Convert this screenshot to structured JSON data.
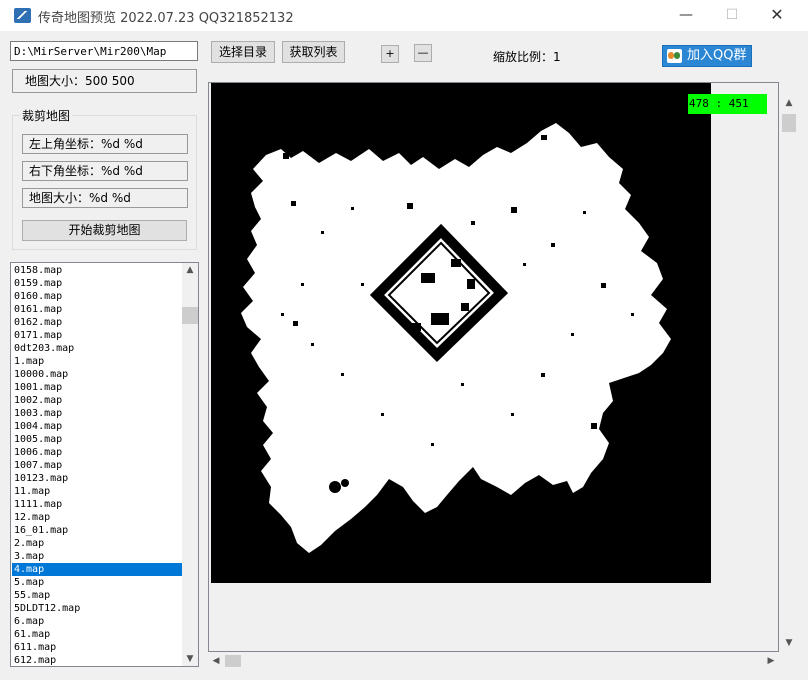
{
  "window": {
    "title": "传奇地图预览 2022.07.23 QQ321852132",
    "minimize": "—",
    "maximize": "☐",
    "close": "✕"
  },
  "toolbar": {
    "path_value": "D:\\MirServer\\Mir200\\Map",
    "select_dir_label": "选择目录",
    "fetch_list_label": "获取列表",
    "zoom_in_label": "+",
    "zoom_out_label": "—",
    "scale_label": "缩放比例：1",
    "qq_group_label": "加入QQ群"
  },
  "left_panel": {
    "map_size_text": "地图大小：500  500",
    "crop_group_title": "裁剪地图",
    "top_left_label": "左上角坐标：%d  %d",
    "bottom_right_label": "右下角坐标：%d  %d",
    "crop_size_label": "地图大小：%d  %d",
    "start_crop_label": "开始裁剪地图"
  },
  "map_list": {
    "items": [
      "0158.map",
      "0159.map",
      "0160.map",
      "0161.map",
      "0162.map",
      "0171.map",
      "0dt203.map",
      "1.map",
      "10000.map",
      "1001.map",
      "1002.map",
      "1003.map",
      "1004.map",
      "1005.map",
      "1006.map",
      "1007.map",
      "10123.map",
      "11.map",
      "1111.map",
      "12.map",
      "16_01.map",
      "2.map",
      "3.map",
      "4.map",
      "5.map",
      "55.map",
      "5DLDT12.map",
      "6.map",
      "61.map",
      "611.map",
      "612.map"
    ],
    "selected": "4.map"
  },
  "viewer": {
    "coordinate_readout": "478 : 451",
    "colors": {
      "walkable": "#ffffff",
      "blocked": "#000000",
      "readout_bg": "#00ff00",
      "selection": "#0078d7"
    }
  },
  "icons": {
    "app": "app-logo-icon",
    "qq": "qq-group-icon",
    "scroll_up": "chevron-up-icon",
    "scroll_down": "chevron-down-icon",
    "scroll_left": "chevron-left-icon",
    "scroll_right": "chevron-right-icon"
  }
}
